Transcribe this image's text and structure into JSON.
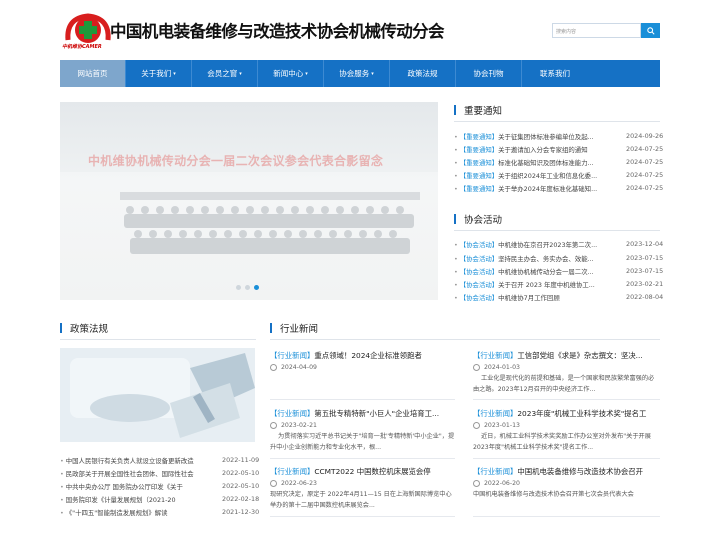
{
  "header": {
    "logo_text": "中机维协CAMER",
    "site_title": "中国机电装备维修与改造技术协会机械传动分会",
    "search_placeholder": "搜索内容"
  },
  "nav": [
    "网站首页",
    "关于我们",
    "会员之窗",
    "新闻中心",
    "协会服务",
    "政策法规",
    "协会刊物",
    "联系我们"
  ],
  "banner": {
    "sign_text": "中机维协机械传动分会一届二次会议参会代表合影留念"
  },
  "notices": {
    "title": "重要通知",
    "items": [
      {
        "tag": "【重要通知】",
        "text": "关于征集团体标准参编单位及起...",
        "date": "2024-09-26"
      },
      {
        "tag": "【重要通知】",
        "text": "关于邀请加入分会专家组的通知",
        "date": "2024-07-25"
      },
      {
        "tag": "【重要通知】",
        "text": "标准化基础知识及团体标准能力...",
        "date": "2024-07-25"
      },
      {
        "tag": "【重要通知】",
        "text": "关于组织2024年工业和信息化委...",
        "date": "2024-07-25"
      },
      {
        "tag": "【重要通知】",
        "text": "关于举办2024年度标准化基础知...",
        "date": "2024-07-25"
      }
    ]
  },
  "activities": {
    "title": "协会活动",
    "items": [
      {
        "tag": "【协会活动】",
        "text": "中机维协在京召开2023年第二次...",
        "date": "2023-12-04"
      },
      {
        "tag": "【协会活动】",
        "text": "坚持民主办会、务实办会、效能...",
        "date": "2023-07-15"
      },
      {
        "tag": "【协会活动】",
        "text": "中机维协机械传动分会一届二次...",
        "date": "2023-07-15"
      },
      {
        "tag": "【协会活动】",
        "text": "关于召开 2023 年度中机维协工...",
        "date": "2023-02-21"
      },
      {
        "tag": "【协会活动】",
        "text": "中机维协7月工作回顾",
        "date": "2022-08-04"
      }
    ]
  },
  "policy": {
    "title": "政策法规",
    "items": [
      {
        "text": "中国人民银行有关负责人就设立设备更新改造",
        "date": "2022-11-09"
      },
      {
        "text": "民政部关于开展全国性社会团体、国际性社会",
        "date": "2022-05-10"
      },
      {
        "text": "中共中央办公厅 国务院办公厅印发《关于",
        "date": "2022-05-10"
      },
      {
        "text": "国务院印发《计量发展规划（2021-20",
        "date": "2022-02-18"
      },
      {
        "text": "《\"十四五\"智能制造发展规划》解读",
        "date": "2021-12-30"
      }
    ]
  },
  "industry": {
    "title": "行业新闻",
    "left": [
      {
        "tag": "【行业新闻】",
        "title": "重点领域！2024企业标准领跑者",
        "date": "2024-04-09",
        "desc": ""
      },
      {
        "tag": "【行业新闻】",
        "title": "第五批专精特新\"小巨人\"企业培育工...",
        "date": "2023-02-21",
        "desc": "为贯彻落实习近平总书记关于\"培育一批'专精特新'中小企业\"，提升中小企业创新能力和专业化水平，根..."
      },
      {
        "tag": "【行业新闻】",
        "title": "CCMT2022 中国数控机床展览会停",
        "date": "2022-06-23",
        "desc": "现研究决定，原定于 2022年4月11—15 日在上海新国际博览中心举办的第十二届中国数控机床展览会..."
      }
    ],
    "right": [
      {
        "tag": "【行业新闻】",
        "title": "工信部党组《求是》杂志撰文：坚决...",
        "date": "2024-01-03",
        "desc": "工业化是现代化的前提和基础，是一个国家和民族繁荣富强的必由之路。2023年12月召开的中央经济工作..."
      },
      {
        "tag": "【行业新闻】",
        "title": "2023年度\"机械工业科学技术奖\"提名工",
        "date": "2023-01-13",
        "desc": "近日，机械工业科学技术奖奖励工作办公室对外发布\"关于开展2023年度\"机械工业科学技术奖\"提名工作..."
      },
      {
        "tag": "【行业新闻】",
        "title": "中国机电装备维修与改造技术协会召开",
        "date": "2022-06-20",
        "desc": "中国机电装备维修与改造技术协会召开第七次会员代表大会"
      }
    ]
  }
}
